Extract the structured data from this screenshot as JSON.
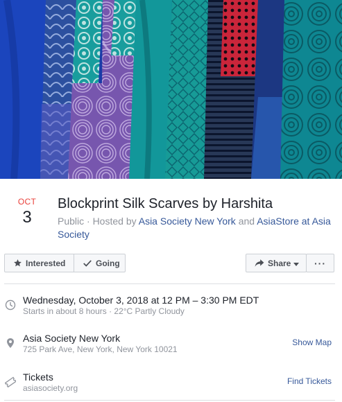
{
  "event": {
    "month": "OCT",
    "day": "3",
    "title": "Blockprint Silk Scarves by Harshita",
    "privacy_prefix": "Public · Hosted by ",
    "host1": "Asia Society New York",
    "conj": " and ",
    "host2": "AsiaStore at Asia Society"
  },
  "actions": {
    "interested_label": "Interested",
    "going_label": "Going",
    "share_label": "Share",
    "more_label": "···"
  },
  "details": {
    "datetime": "Wednesday, October 3, 2018 at 12 PM – 3:30 PM EDT",
    "datetime_sub": "Starts in about 8 hours · 22°C Partly Cloudy",
    "venue": "Asia Society New York",
    "address": "725 Park Ave, New York, New York 10021",
    "show_map_label": "Show Map",
    "tickets_label": "Tickets",
    "tickets_site": "asiasociety.org",
    "find_tickets_label": "Find Tickets"
  },
  "icons": {
    "interested": "star-icon",
    "going": "checkmark-icon",
    "share": "share-arrow-icon",
    "clock": "clock-icon",
    "location": "map-pin-icon",
    "ticket": "ticket-icon"
  },
  "colors": {
    "month": "#e9403a",
    "link": "#365899",
    "secondary_text": "#90949c",
    "button_bg": "#f6f7f9"
  }
}
